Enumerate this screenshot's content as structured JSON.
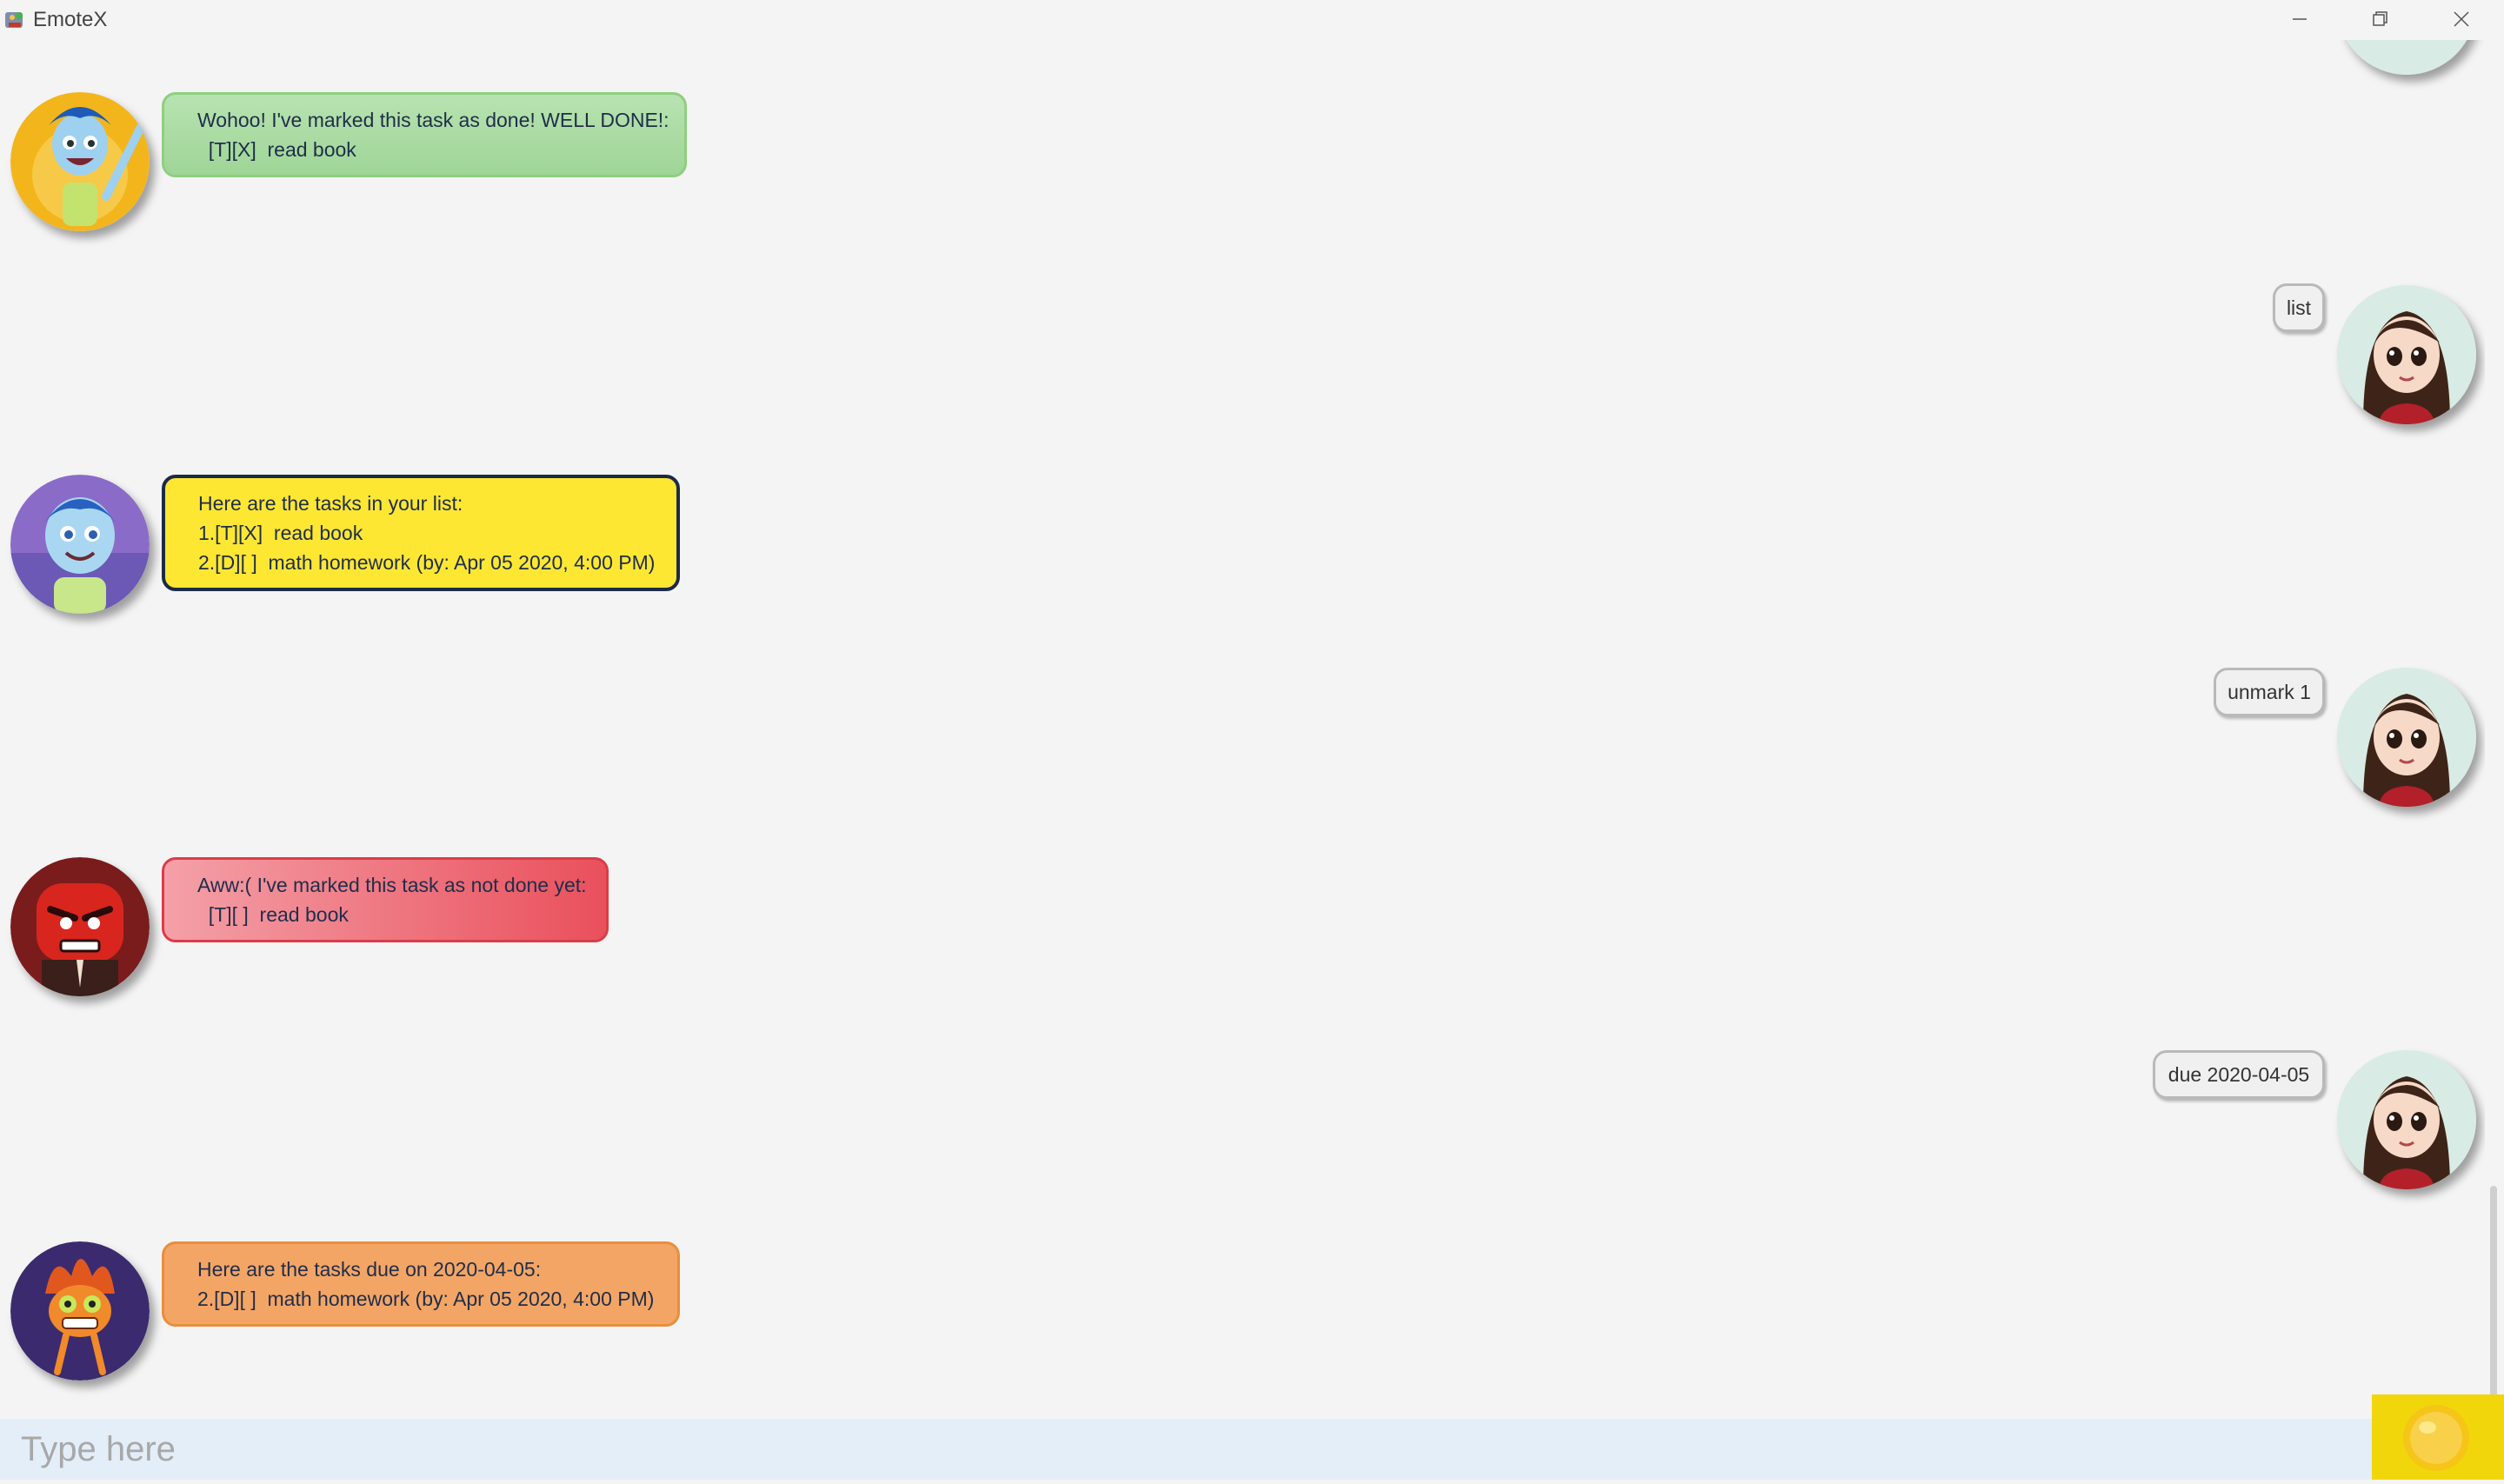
{
  "window": {
    "title": "EmoteX"
  },
  "messages": [
    {
      "sender": "bot",
      "mood": "happy",
      "lines": [
        "Wohoo! I've marked this task as done! WELL DONE!:",
        "  [T][X]  read book"
      ]
    },
    {
      "sender": "user",
      "text": "list"
    },
    {
      "sender": "bot",
      "mood": "joy",
      "lines": [
        "Here are the tasks in your list:",
        "1.[T][X]  read book",
        "2.[D][ ]  math homework (by: Apr 05 2020, 4:00 PM)"
      ]
    },
    {
      "sender": "user",
      "text": "unmark 1"
    },
    {
      "sender": "bot",
      "mood": "angry",
      "lines": [
        "Aww:( I've marked this task as not done yet:",
        "  [T][ ]  read book"
      ]
    },
    {
      "sender": "user",
      "text": "due 2020-04-05"
    },
    {
      "sender": "bot",
      "mood": "anxious",
      "lines": [
        "Here are the tasks due on 2020-04-05:",
        "2.[D][ ]  math homework (by: Apr 05 2020, 4:00 PM)"
      ]
    }
  ],
  "input": {
    "placeholder": "Type here",
    "value": ""
  },
  "icons": {
    "app": "app-icon",
    "minimize": "minimize-icon",
    "restore": "restore-icon",
    "close": "close-icon",
    "send": "send-icon"
  },
  "colors": {
    "happy_bubble": "#a8dba0",
    "list_bubble": "#fde732",
    "angry_bubble": "#ec6872",
    "anxious_bubble": "#f3a565",
    "input_bar": "#e3eef8",
    "send_button": "#f2d60c"
  }
}
